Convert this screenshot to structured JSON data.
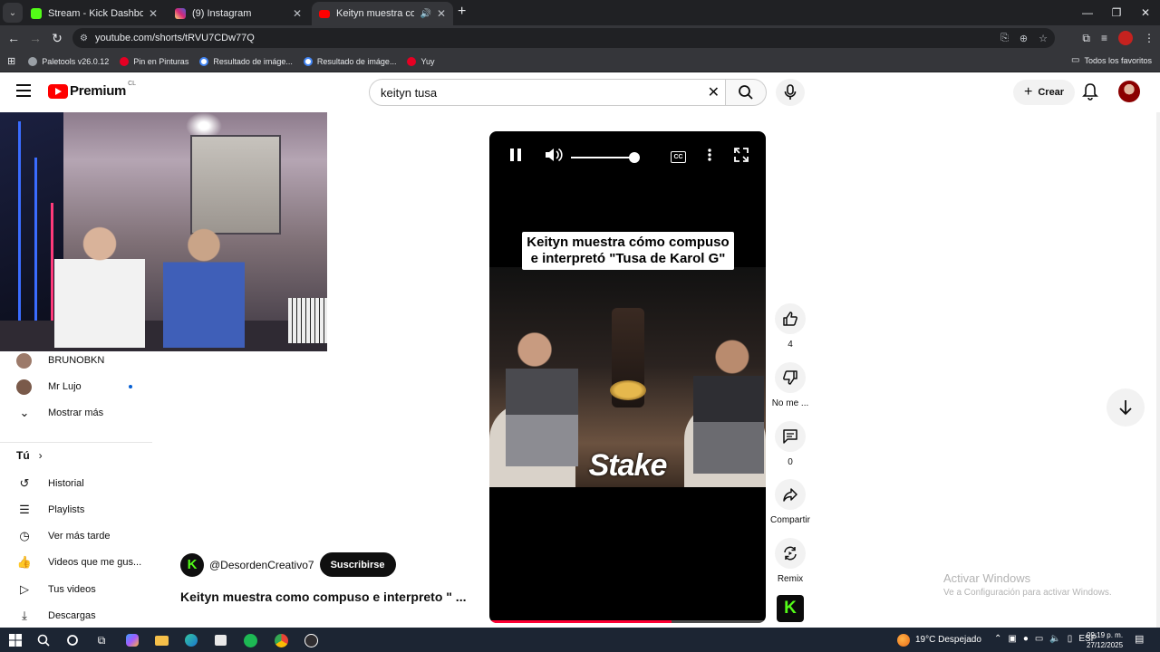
{
  "browser": {
    "tabs": [
      {
        "title": "Stream - Kick Dashboard",
        "color": "#53fc18"
      },
      {
        "title": "(9) Instagram",
        "color": "#d62976"
      },
      {
        "title": "Keityn muestra como compuso e interpretó",
        "color": "#ff0000"
      }
    ],
    "url": "youtube.com/shorts/tRVU7CDw77Q",
    "bookmarks": [
      {
        "label": "Paletools v26.0.12",
        "color": "#9aa0a6"
      },
      {
        "label": "Pin en Pinturas",
        "color": "#e60023"
      },
      {
        "label": "Resultado de imáge...",
        "color": "#4285f4"
      },
      {
        "label": "Resultado de imáge...",
        "color": "#4285f4"
      },
      {
        "label": "Yuy",
        "color": "#e60023"
      }
    ],
    "all_bookmarks": "Todos los favoritos"
  },
  "youtube": {
    "logo": "Premium",
    "country": "CL",
    "search_value": "keityn tusa",
    "create_label": "Crear"
  },
  "sidebar": {
    "subscriptions": [
      {
        "label": "BRUNOBKN",
        "color": "#9c7a6a",
        "live": false
      },
      {
        "label": "Mr Lujo",
        "color": "#7a5a4a",
        "live": true
      }
    ],
    "show_more": "Mostrar más",
    "you_section": "Tú",
    "you_items": [
      {
        "label": "Historial",
        "icon": "history-icon"
      },
      {
        "label": "Playlists",
        "icon": "playlists-icon"
      },
      {
        "label": "Ver más tarde",
        "icon": "clock-icon"
      },
      {
        "label": "Videos que me gus...",
        "icon": "thumbs-up-icon"
      },
      {
        "label": "Tus videos",
        "icon": "video-icon"
      },
      {
        "label": "Descargas",
        "icon": "download-icon"
      }
    ]
  },
  "short": {
    "caption_line1": "Keityn muestra cómo compuso",
    "caption_line2": "e interpretó \"Tusa de Karol G\"",
    "sponsor": "Stake",
    "channel_name": "@DesordenCreativo7",
    "channel_initial": "K",
    "subscribe": "Suscribirse",
    "title": "Keityn muestra como compuso e interpreto \" ...",
    "progress": 0.66,
    "volume": 0.9
  },
  "actions": {
    "likes": "4",
    "dislike": "No me ...",
    "comments": "0",
    "share": "Compartir",
    "remix": "Remix",
    "sound_initial": "K"
  },
  "watermark": {
    "line1": "Activar Windows",
    "line2": "Ve a Configuración para activar Windows."
  },
  "taskbar": {
    "weather": "19°C  Despejado",
    "lang": "ESP",
    "time": "09:19 p. m.",
    "date": "27/12/2025"
  }
}
